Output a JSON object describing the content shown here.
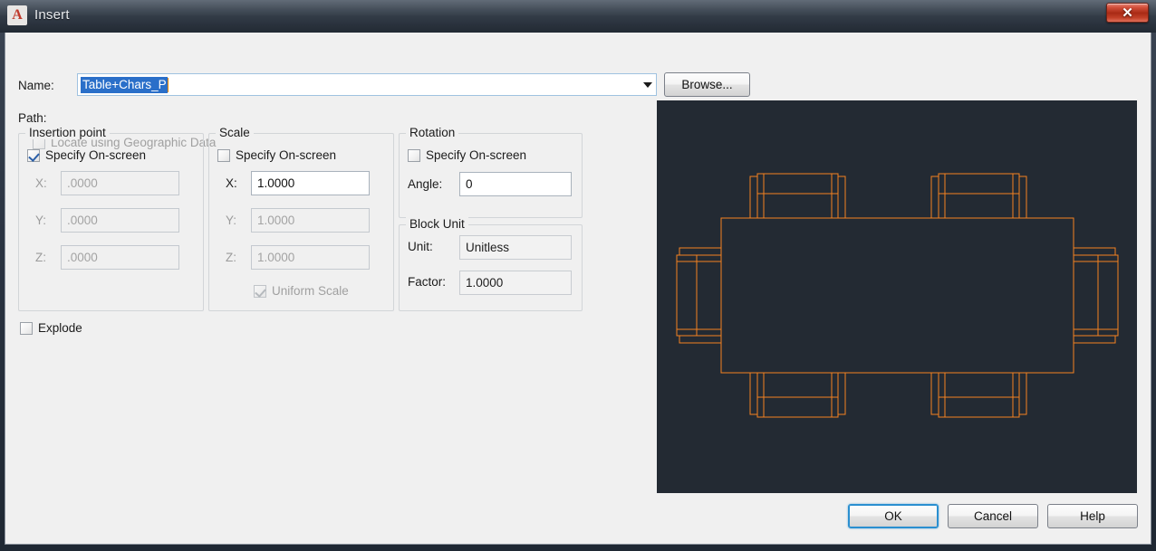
{
  "window": {
    "title": "Insert",
    "app_icon": "autocad-a-icon",
    "close_label": "✕",
    "accent_color": "#2a8fd0",
    "titlebar_color": "#39434f"
  },
  "name_row": {
    "label": "Name:",
    "value": "Table+Chars_P",
    "browse_label": "Browse...",
    "dropdown_icon": "chevron-down-icon"
  },
  "path_row": {
    "label": "Path:",
    "value": ""
  },
  "geographic": {
    "label": "Locate using Geographic Data",
    "checked": false,
    "enabled": false
  },
  "insertion_point": {
    "title": "Insertion point",
    "specify_label": "Specify On-screen",
    "specify_checked": true,
    "fields": [
      {
        "label": "X:",
        "value": ".0000",
        "enabled": false
      },
      {
        "label": "Y:",
        "value": ".0000",
        "enabled": false
      },
      {
        "label": "Z:",
        "value": ".0000",
        "enabled": false
      }
    ]
  },
  "scale": {
    "title": "Scale",
    "specify_label": "Specify On-screen",
    "specify_checked": false,
    "fields": [
      {
        "label": "X:",
        "value": "1.0000",
        "enabled": true
      },
      {
        "label": "Y:",
        "value": "1.0000",
        "enabled": false
      },
      {
        "label": "Z:",
        "value": "1.0000",
        "enabled": false
      }
    ],
    "uniform_label": "Uniform Scale",
    "uniform_checked": true,
    "uniform_enabled": false
  },
  "rotation": {
    "title": "Rotation",
    "specify_label": "Specify On-screen",
    "specify_checked": false,
    "angle_label": "Angle:",
    "angle_value": "0"
  },
  "block_unit": {
    "title": "Block Unit",
    "unit_label": "Unit:",
    "unit_value": "Unitless",
    "factor_label": "Factor:",
    "factor_value": "1.0000"
  },
  "explode": {
    "label": "Explode",
    "checked": false
  },
  "preview": {
    "name": "block-preview",
    "background_color": "#232a33",
    "line_color": "#f58220",
    "description": "Conference table plan view with six chairs"
  },
  "footer": {
    "ok_label": "OK",
    "cancel_label": "Cancel",
    "help_label": "Help"
  }
}
